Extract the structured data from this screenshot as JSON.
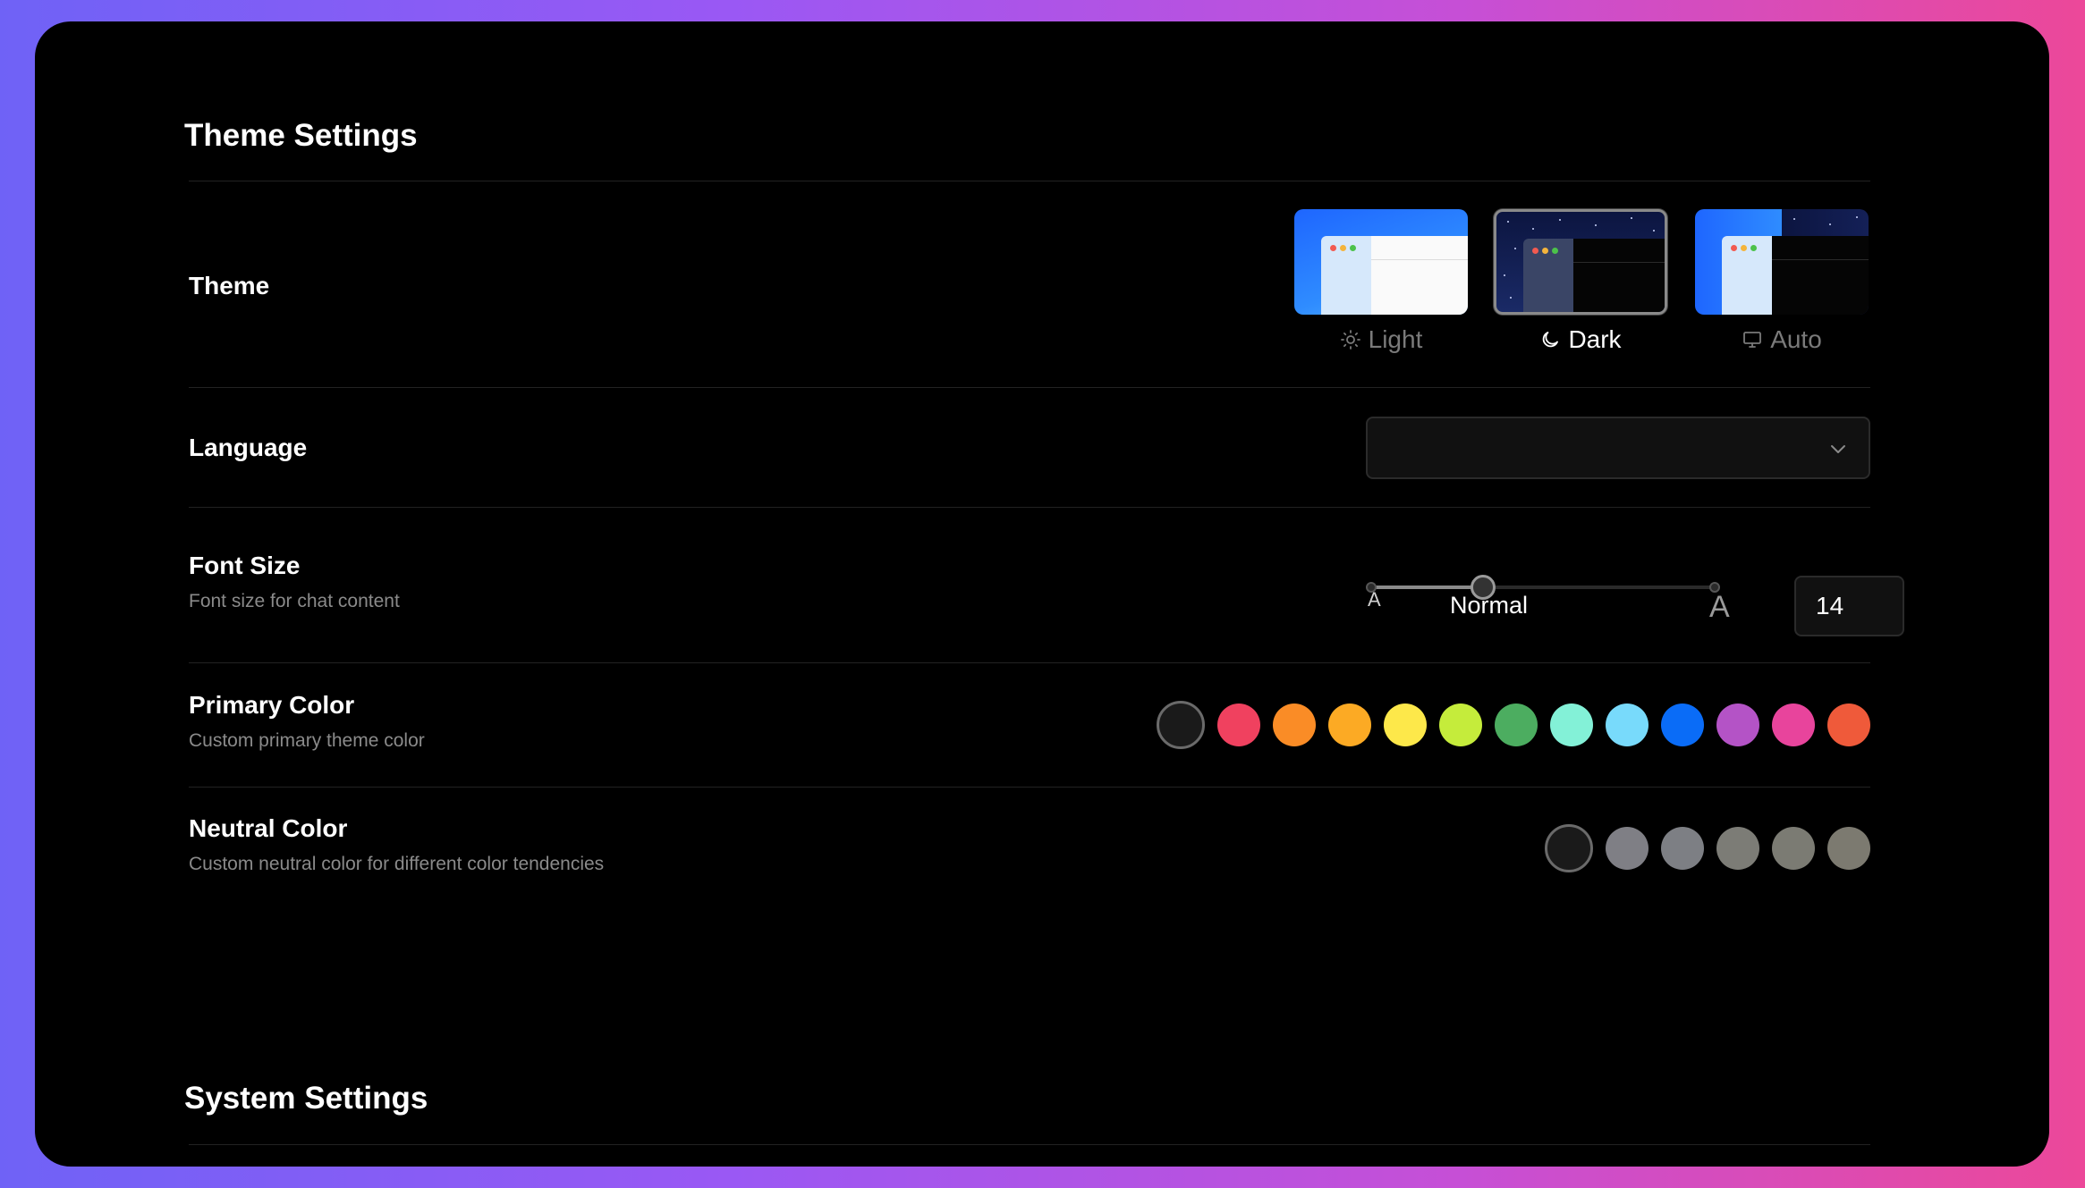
{
  "theme_settings": {
    "title": "Theme Settings",
    "theme": {
      "label": "Theme",
      "options": [
        {
          "label": "Light",
          "icon": "sun-icon"
        },
        {
          "label": "Dark",
          "icon": "moon-icon",
          "selected": true
        },
        {
          "label": "Auto",
          "icon": "monitor-icon"
        }
      ]
    },
    "language": {
      "label": "Language",
      "value": ""
    },
    "font_size": {
      "label": "Font Size",
      "description": "Font size for chat content",
      "small_label": "A",
      "large_label": "A",
      "current_label": "Normal",
      "value": "14",
      "slider_fraction": 0.33
    },
    "primary_color": {
      "label": "Primary Color",
      "description": "Custom primary theme color",
      "colors": [
        "#1a1a1a",
        "#f0415f",
        "#fa8c26",
        "#fcaa24",
        "#fde84a",
        "#c5ec3b",
        "#4cad60",
        "#83f1d7",
        "#78dafb",
        "#0a6cf7",
        "#b453c6",
        "#e8449c",
        "#ef5a3a"
      ],
      "selected_index": 0
    },
    "neutral_color": {
      "label": "Neutral Color",
      "description": "Custom neutral color for different color tendencies",
      "colors": [
        "#1a1a1a",
        "#7f7f85",
        "#7d7f84",
        "#7c7c76",
        "#7b7b73",
        "#7c7a70"
      ],
      "selected_index": 0
    }
  },
  "system_settings": {
    "title": "System Settings"
  }
}
